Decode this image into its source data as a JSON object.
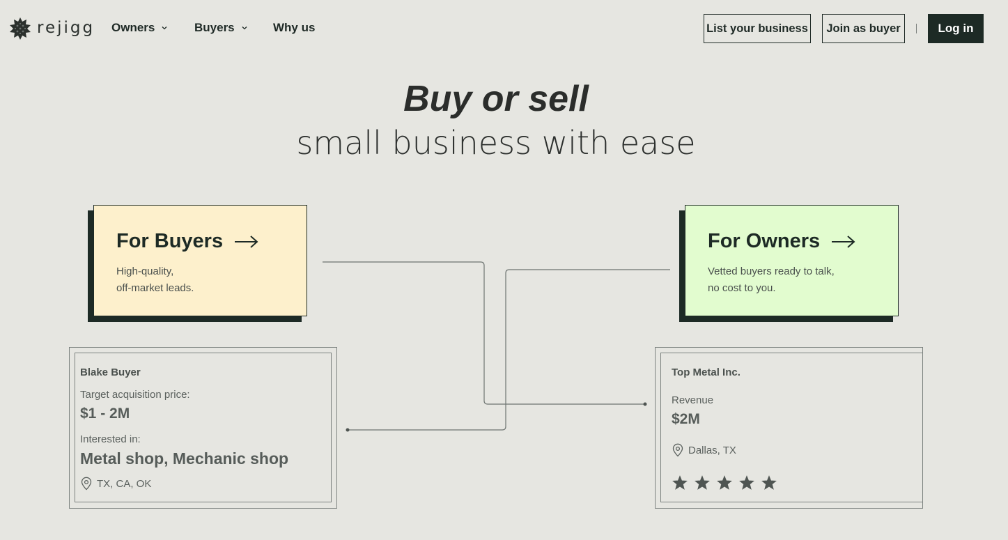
{
  "header": {
    "logo_text": "rejigg",
    "nav": {
      "owners": "Owners",
      "buyers": "Buyers",
      "why_us": "Why us"
    },
    "list_business_label": "List your business",
    "join_buyer_label": "Join as buyer",
    "login_label": "Log in"
  },
  "hero": {
    "line1": "Buy or sell",
    "line2": "small business with ease"
  },
  "cards": {
    "buyers": {
      "title": "For Buyers",
      "desc_line1": "High-quality,",
      "desc_line2": "off-market leads.",
      "color": "#fdf0cc"
    },
    "owners": {
      "title": "For Owners",
      "desc_line1": "Vetted buyers ready to talk,",
      "desc_line2": "no cost to you.",
      "color": "#e2fccf"
    }
  },
  "buyer_profile": {
    "name": "Blake Buyer",
    "price_label": "Target acquisition price:",
    "price_value": "$1 - 2M",
    "interest_label": "Interested in:",
    "interest_value": "Metal shop, Mechanic shop",
    "location": "TX, CA, OK"
  },
  "business_profile": {
    "name": "Top Metal Inc.",
    "revenue_label": "Revenue",
    "revenue_value": "$2M",
    "location": "Dallas, TX",
    "rating": 5,
    "rating_max": 5
  },
  "colors": {
    "background": "#e6e6e1",
    "dark": "#1d2a25"
  }
}
